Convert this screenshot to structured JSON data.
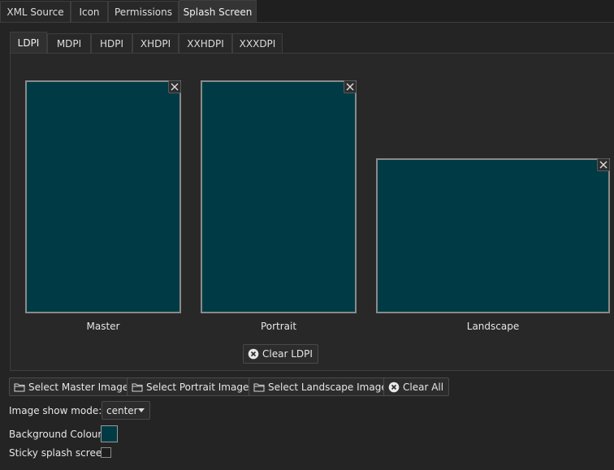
{
  "top_tabs": [
    {
      "label": "XML Source",
      "active": false
    },
    {
      "label": "Icon",
      "active": false
    },
    {
      "label": "Permissions",
      "active": false
    },
    {
      "label": "Splash Screen",
      "active": true
    }
  ],
  "density_tabs": [
    {
      "label": "LDPI",
      "active": true
    },
    {
      "label": "MDPI",
      "active": false
    },
    {
      "label": "HDPI",
      "active": false
    },
    {
      "label": "XHDPI",
      "active": false
    },
    {
      "label": "XXHDPI",
      "active": false
    },
    {
      "label": "XXXDPI",
      "active": false
    }
  ],
  "previews": {
    "master": {
      "caption": "Master"
    },
    "portrait": {
      "caption": "Portrait"
    },
    "landscape": {
      "caption": "Landscape"
    }
  },
  "clear_density_label": "Clear LDPI",
  "actions": {
    "select_master": "Select Master Image",
    "select_portrait": "Select Portrait Image",
    "select_landscape": "Select Landscape Image",
    "clear_all": "Clear All"
  },
  "settings": {
    "show_mode_label": "Image show mode:",
    "show_mode_value": "center",
    "background_label": "Background Colour:",
    "background_color": "#003b45",
    "sticky_label": "Sticky splash screen:",
    "sticky_checked": false
  },
  "icons": {
    "close": "close-icon",
    "folder": "folder-icon",
    "clear": "clear-circle-icon"
  }
}
